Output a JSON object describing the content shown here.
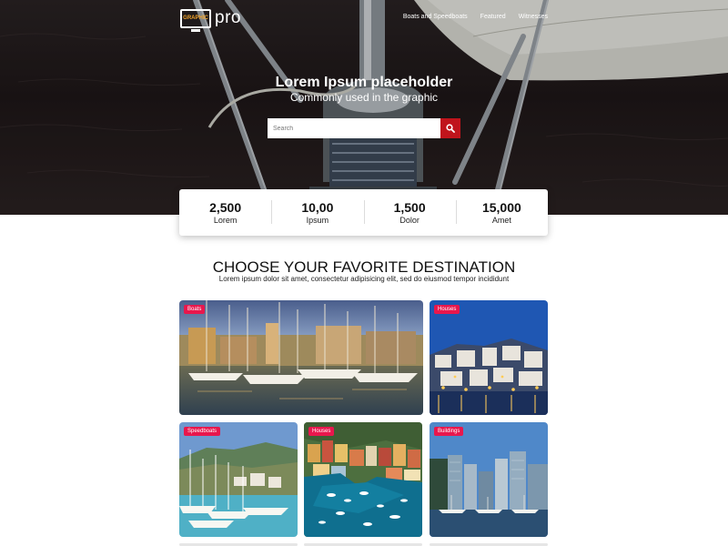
{
  "header": {
    "logo_text": "pro",
    "logo_mark_text": "GRAPHIC",
    "nav": [
      "Boats and Speedboats",
      "Featured",
      "Witnesses"
    ]
  },
  "hero": {
    "title": "Lorem Ipsum placeholder",
    "subtitle": "Commonly used in the graphic",
    "search_placeholder": "Search"
  },
  "stats": [
    {
      "value": "2,500",
      "label": "Lorem"
    },
    {
      "value": "10,00",
      "label": "Ipsum"
    },
    {
      "value": "1,500",
      "label": "Dolor"
    },
    {
      "value": "15,000",
      "label": "Amet"
    }
  ],
  "section": {
    "title": "CHOOSE YOUR FAVORITE DESTINATION",
    "subtitle": "Lorem ipsum dolor sit amet, consectetur adipisicing elit, sed do eiusmod tempor incididunt"
  },
  "cards": [
    {
      "tag": "Boats",
      "scene": "harbor-sunset"
    },
    {
      "tag": "Houses",
      "scene": "hillside-town-night"
    },
    {
      "tag": "Speedboats",
      "scene": "marina-mountains"
    },
    {
      "tag": "Houses",
      "scene": "colorful-port-village"
    },
    {
      "tag": "Buildings",
      "scene": "city-skyline-waterfront"
    }
  ],
  "colors": {
    "accent": "#e8174d",
    "search_button": "#c0141c"
  },
  "icons": {
    "search": "search-icon",
    "logo": "monitor-logo-icon"
  }
}
